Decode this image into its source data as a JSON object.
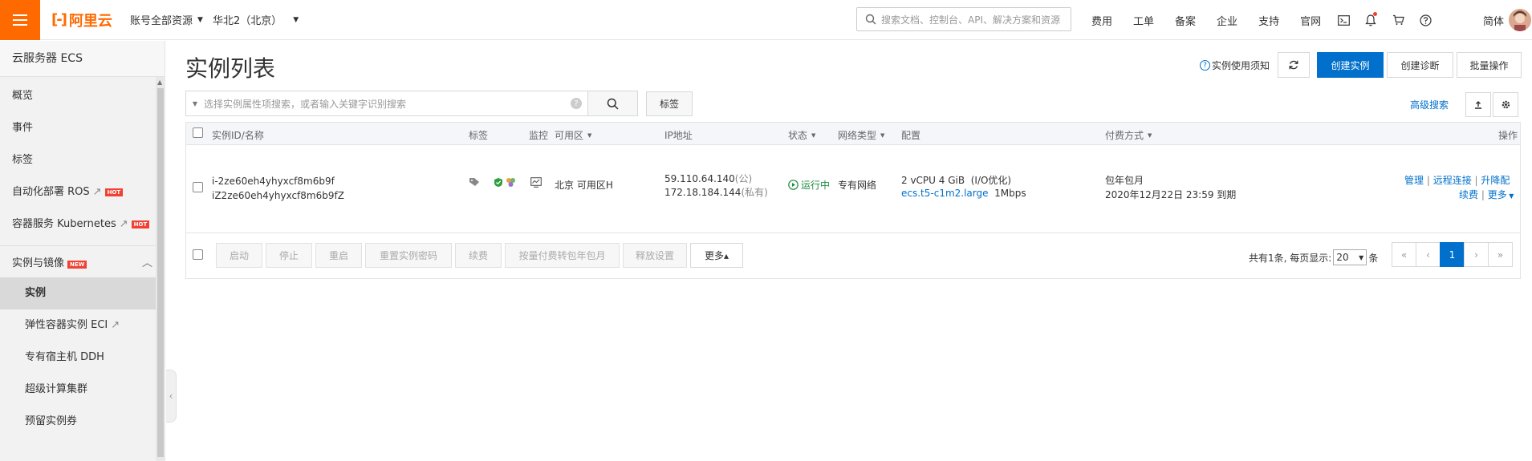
{
  "header": {
    "logo_text": "阿里云",
    "account_scope": "账号全部资源",
    "region": "华北2（北京）",
    "search_placeholder": "搜索文档、控制台、API、解决方案和资源",
    "nav": [
      "费用",
      "工单",
      "备案",
      "企业",
      "支持",
      "官网"
    ],
    "language": "简体"
  },
  "sidebar": {
    "title": "云服务器 ECS",
    "items": [
      {
        "label": "概览"
      },
      {
        "label": "事件"
      },
      {
        "label": "标签"
      },
      {
        "label": "自动化部署 ROS",
        "badge": "HOT"
      },
      {
        "label": "容器服务 Kubernetes",
        "badge": "HOT"
      }
    ],
    "group": {
      "label": "实例与镜像",
      "badge": "NEW"
    },
    "sub_items": [
      {
        "label": "实例"
      },
      {
        "label": "弹性容器实例 ECI"
      },
      {
        "label": "专有宿主机 DDH"
      },
      {
        "label": "超级计算集群"
      },
      {
        "label": "预留实例券"
      }
    ]
  },
  "main": {
    "title": "实例列表",
    "notice": "实例使用须知",
    "create_button": "创建实例",
    "diagnose_button": "创建诊断",
    "batch_button": "批量操作",
    "search_placeholder": "选择实例属性项搜索，或者输入关键字识别搜索",
    "tag_button": "标签",
    "advanced_search": "高级搜索"
  },
  "table": {
    "headers": {
      "id_name": "实例ID/名称",
      "tags": "标签",
      "monitor": "监控",
      "zone": "可用区",
      "ip": "IP地址",
      "status": "状态",
      "network": "网络类型",
      "config": "配置",
      "billing": "付费方式",
      "actions": "操作"
    },
    "rows": [
      {
        "instance_id": "i-2ze60eh4yhyxcf8m6b9f",
        "name": "iZ2ze60eh4yhyxcf8m6b9fZ",
        "zone": "北京 可用区H",
        "public_ip": "59.110.64.140",
        "public_suffix": "(公)",
        "private_ip": "172.18.184.144",
        "private_suffix": "(私有)",
        "status": "运行中",
        "network": "专有网络",
        "config_spec": "2 vCPU 4 GiB",
        "config_io": "(I/O优化)",
        "instance_type": "ecs.t5-c1m2.large",
        "bandwidth": "1Mbps",
        "billing_type": "包年包月",
        "expire": "2020年12月22日 23:59 到期",
        "actions": {
          "manage": "管理",
          "remote": "远程连接",
          "upgrade": "升降配",
          "renew": "续费",
          "more": "更多"
        }
      }
    ]
  },
  "footer": {
    "buttons": [
      "启动",
      "停止",
      "重启",
      "重置实例密码",
      "续费",
      "按量付费转包年包月",
      "释放设置"
    ],
    "more": "更多▴",
    "total_text": "共有1条, 每页显示:",
    "page_size": "20",
    "page_size_suffix": "条",
    "current_page": "1"
  }
}
